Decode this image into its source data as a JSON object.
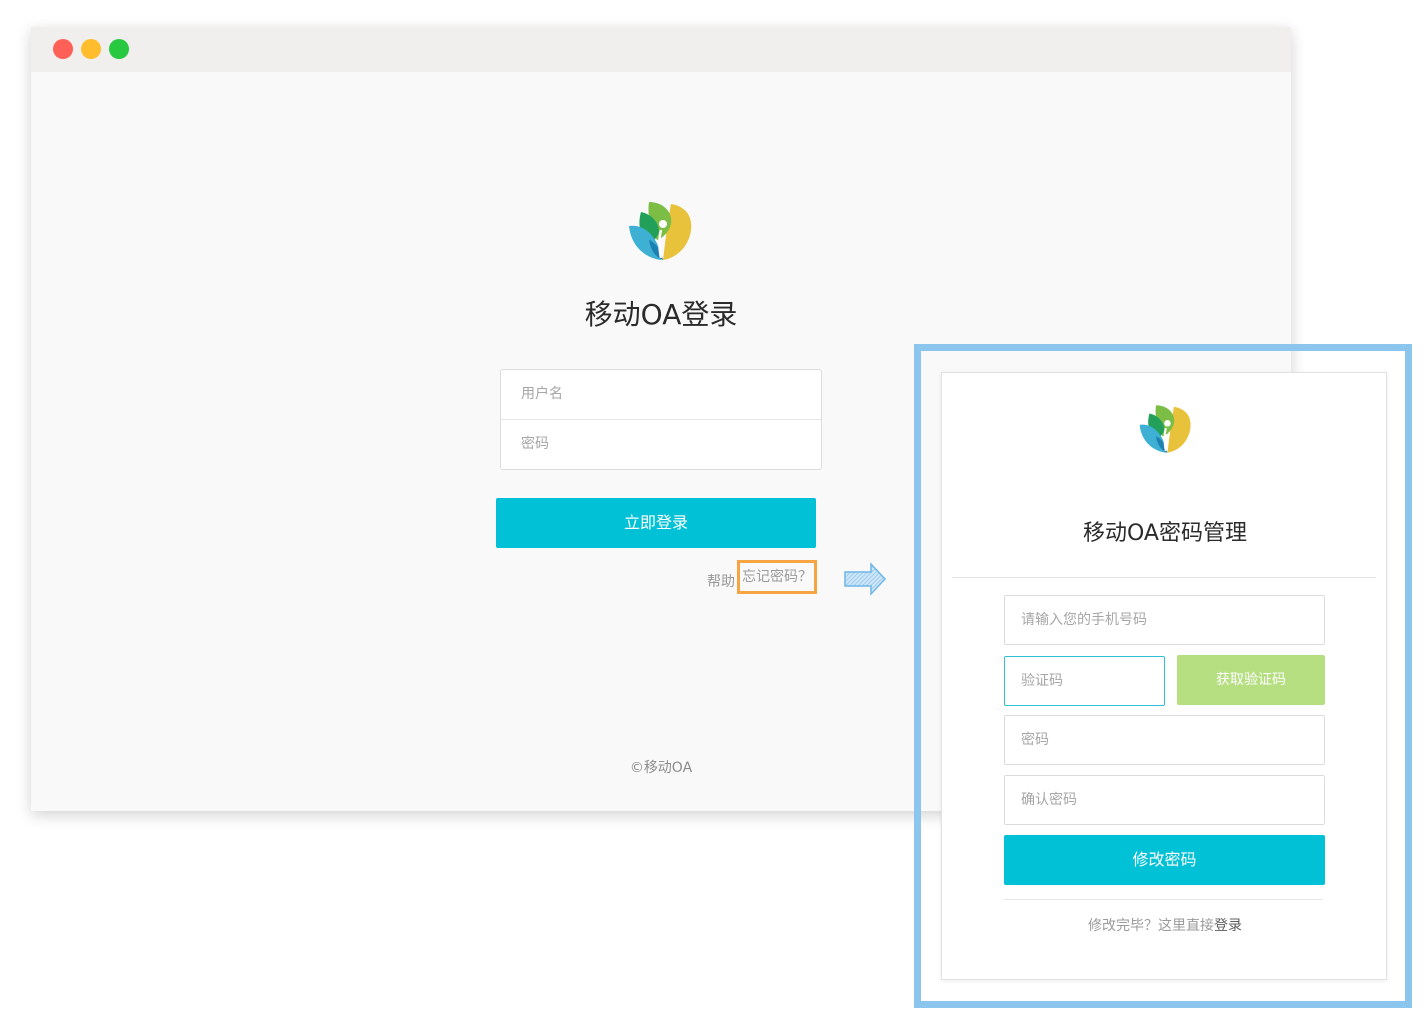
{
  "colors": {
    "primary_button": "#00c1d5",
    "code_button": "#b6df82",
    "forgot_highlight": "#f7a442",
    "popup_highlight": "#8cc6ee",
    "window_bg": "#f9f9f9",
    "traffic_red": "#fe5f57",
    "traffic_yellow": "#ffbd2e",
    "traffic_green": "#28c840"
  },
  "login": {
    "title": "移动OA登录",
    "username_placeholder": "用户名",
    "password_placeholder": "密码",
    "submit_label": "立即登录",
    "help_label": "帮助",
    "forgot_label": "忘记密码？",
    "copyright": "©移动OA"
  },
  "reset": {
    "title": "移动OA密码管理",
    "phone_placeholder": "请输入您的手机号码",
    "code_placeholder": "验证码",
    "get_code_label": "获取验证码",
    "password_placeholder": "密码",
    "confirm_placeholder": "确认密码",
    "submit_label": "修改密码",
    "footer_prefix": "修改完毕？这里直接",
    "footer_link": "登录"
  },
  "icons": {
    "logo": "leaf-logo-icon",
    "arrow": "right-arrow-icon"
  }
}
